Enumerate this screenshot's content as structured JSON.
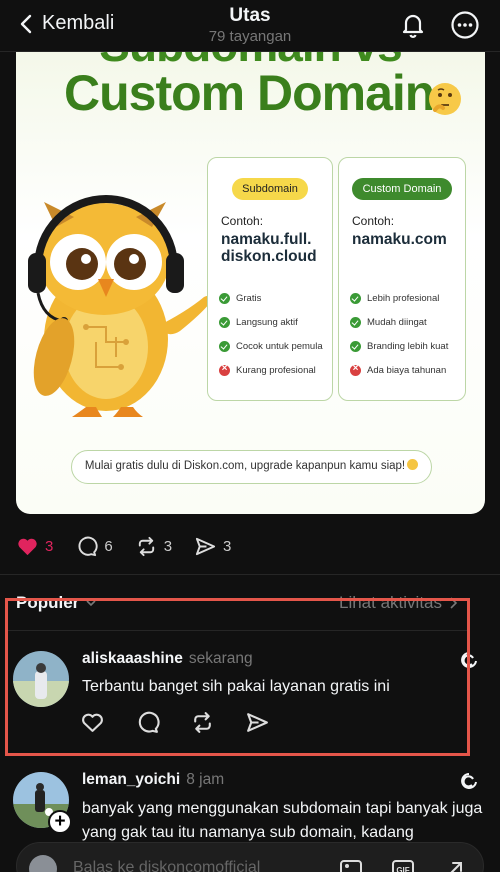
{
  "header": {
    "back_label": "Kembali",
    "title": "Utas",
    "subtitle": "79 tayangan"
  },
  "post_image": {
    "title": "Custom Domain",
    "title_top": "Subdomain vs",
    "box1": {
      "pill": "Subdomain",
      "contoh_label": "Contoh:",
      "domain_line1": "namaku.full.",
      "domain_line2": "diskon.cloud",
      "items": [
        {
          "text": "Gratis",
          "status": "ok"
        },
        {
          "text": "Langsung aktif",
          "status": "ok"
        },
        {
          "text": "Cocok untuk pemula",
          "status": "ok"
        },
        {
          "text": "Kurang profesional",
          "status": "no"
        }
      ]
    },
    "box2": {
      "pill": "Custom Domain",
      "contoh_label": "Contoh:",
      "domain_line1": "namaku.com",
      "items": [
        {
          "text": "Lebih profesional",
          "status": "ok"
        },
        {
          "text": "Mudah diingat",
          "status": "ok"
        },
        {
          "text": "Branding lebih kuat",
          "status": "ok"
        },
        {
          "text": "Ada biaya tahunan",
          "status": "no"
        }
      ]
    },
    "banner": "Mulai gratis dulu di Diskon.com, upgrade kapanpun kamu siap!"
  },
  "actions": {
    "likes": "3",
    "comments": "6",
    "reposts": "3",
    "shares": "3",
    "like_color": "#e0245e"
  },
  "section": {
    "label": "Populer",
    "link": "Lihat aktivitas"
  },
  "replies": [
    {
      "username": "aliskaaashine",
      "time": "sekarang",
      "text": "Terbantu banget sih pakai layanan gratis ini"
    },
    {
      "username": "leman_yoichi",
      "time": "8 jam",
      "text": "banyak yang menggunakan subdomain tapi banyak juga yang gak tau itu namanya sub domain, kadang"
    }
  ],
  "reply_input": {
    "placeholder": "Balas ke diskoncomofficial"
  },
  "colors": {
    "highlight": "#e4564a",
    "background": "#101010"
  }
}
